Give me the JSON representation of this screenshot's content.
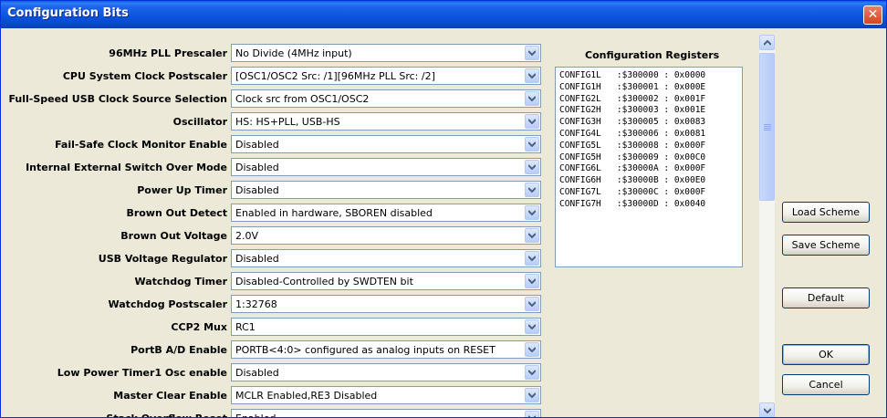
{
  "window": {
    "title": "Configuration Bits",
    "close_glyph": "✕"
  },
  "settings": [
    {
      "label": "96MHz PLL Prescaler",
      "value": "No Divide (4MHz input)"
    },
    {
      "label": "CPU System Clock Postscaler",
      "value": "[OSC1/OSC2 Src: /1][96MHz PLL Src: /2]"
    },
    {
      "label": "Full-Speed USB Clock Source Selection",
      "value": "Clock src from OSC1/OSC2"
    },
    {
      "label": "Oscillator",
      "value": "HS: HS+PLL, USB-HS"
    },
    {
      "label": "Fail-Safe Clock Monitor Enable",
      "value": "Disabled"
    },
    {
      "label": "Internal External Switch Over Mode",
      "value": "Disabled"
    },
    {
      "label": "Power Up Timer",
      "value": "Disabled"
    },
    {
      "label": "Brown Out Detect",
      "value": "Enabled in hardware, SBOREN disabled"
    },
    {
      "label": "Brown Out Voltage",
      "value": "2.0V"
    },
    {
      "label": "USB Voltage Regulator",
      "value": "Disabled"
    },
    {
      "label": "Watchdog Timer",
      "value": "Disabled-Controlled by SWDTEN bit"
    },
    {
      "label": "Watchdog Postscaler",
      "value": "1:32768"
    },
    {
      "label": "CCP2 Mux",
      "value": "RC1"
    },
    {
      "label": "PortB A/D Enable",
      "value": "PORTB<4:0> configured as analog inputs on RESET"
    },
    {
      "label": "Low Power Timer1 Osc enable",
      "value": "Disabled"
    },
    {
      "label": "Master Clear Enable",
      "value": "MCLR Enabled,RE3 Disabled"
    },
    {
      "label": "Stack Overflow Reset",
      "value": "Enabled"
    }
  ],
  "registers": {
    "title": "Configuration Registers",
    "lines": [
      "CONFIG1L   :$300000 : 0x0000",
      "CONFIG1H   :$300001 : 0x000E",
      "CONFIG2L   :$300002 : 0x001F",
      "CONFIG2H   :$300003 : 0x001E",
      "CONFIG3H   :$300005 : 0x0083",
      "CONFIG4L   :$300006 : 0x0081",
      "CONFIG5L   :$300008 : 0x000F",
      "CONFIG5H   :$300009 : 0x00C0",
      "CONFIG6L   :$30000A : 0x000F",
      "CONFIG6H   :$30000B : 0x00E0",
      "CONFIG7L   :$30000C : 0x000F",
      "CONFIG7H   :$30000D : 0x0040"
    ]
  },
  "buttons": {
    "load": "Load Scheme",
    "save": "Save Scheme",
    "default": "Default",
    "ok": "OK",
    "cancel": "Cancel"
  },
  "colors": {
    "titlebar": "#0a53dc",
    "face": "#ece9d8",
    "close": "#d2461e"
  }
}
